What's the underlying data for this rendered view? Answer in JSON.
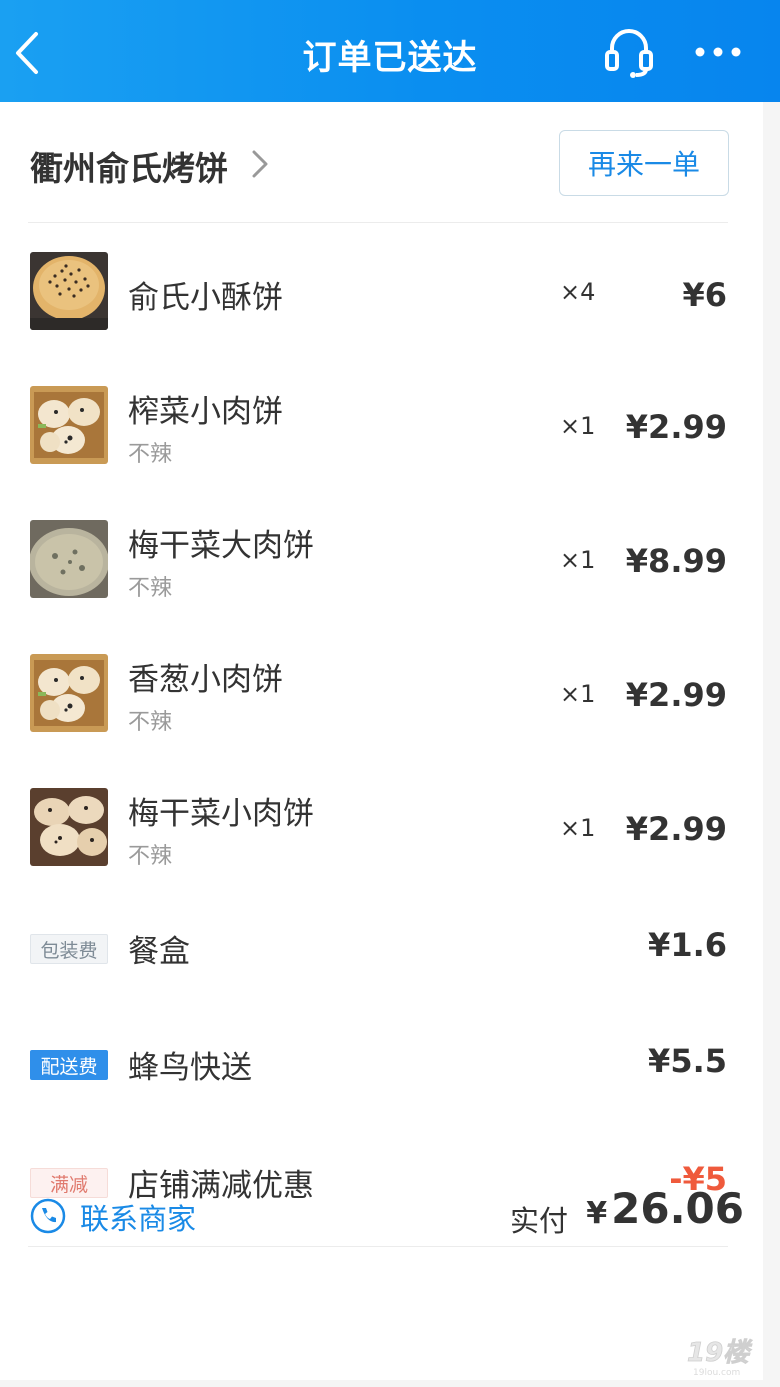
{
  "header": {
    "title": "订单已送达",
    "back_icon": "back-arrow-icon",
    "service_icon": "headset-icon",
    "more_icon": "more-dots-icon"
  },
  "shop": {
    "name": "衢州俞氏烤饼",
    "reorder_label": "再来一单"
  },
  "items": [
    {
      "name": "俞氏小酥饼",
      "spec": "",
      "qty": "×4",
      "price": "¥6"
    },
    {
      "name": "榨菜小肉饼",
      "spec": "不辣",
      "qty": "×1",
      "price": "¥2.99"
    },
    {
      "name": "梅干菜大肉饼",
      "spec": "不辣",
      "qty": "×1",
      "price": "¥8.99"
    },
    {
      "name": "香葱小肉饼",
      "spec": "不辣",
      "qty": "×1",
      "price": "¥2.99"
    },
    {
      "name": "梅干菜小肉饼",
      "spec": "不辣",
      "qty": "×1",
      "price": "¥2.99"
    }
  ],
  "fees": [
    {
      "tag": "包装费",
      "label": "餐盒",
      "value": "¥1.6"
    },
    {
      "tag": "配送费",
      "label": "蜂鸟快送",
      "value": "¥5.5"
    },
    {
      "tag": "满减",
      "label": "店铺满减优惠",
      "value": "-¥5"
    }
  ],
  "footer": {
    "contact_label": "联系商家",
    "paid_label": "实付",
    "paid_currency": "¥",
    "paid_amount": "26.06"
  },
  "watermark": {
    "text": "19楼",
    "subtext": "19lou.com"
  },
  "colors": {
    "header_blue": "#0a8ef0",
    "link_blue": "#1a8ae6",
    "discount_red": "#ef5a3c"
  }
}
